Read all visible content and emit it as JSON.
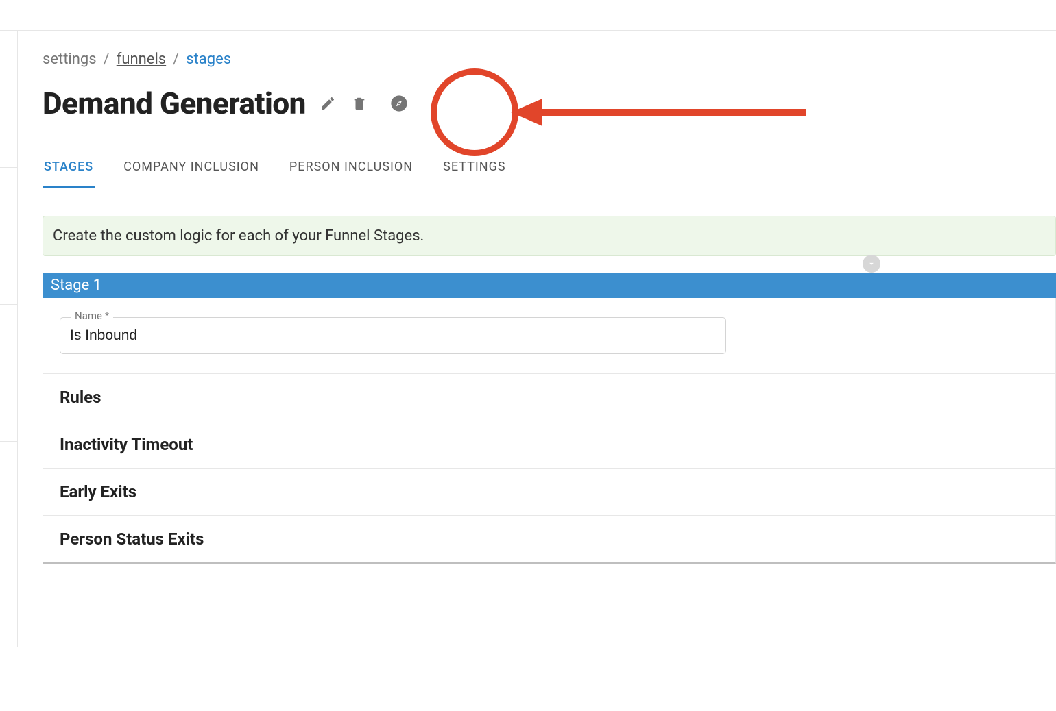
{
  "breadcrumb": {
    "settings": "settings",
    "funnels": "funnels",
    "stages": "stages"
  },
  "header": {
    "title": "Demand Generation"
  },
  "tabs": [
    {
      "label": "STAGES",
      "active": true
    },
    {
      "label": "COMPANY INCLUSION",
      "active": false
    },
    {
      "label": "PERSON INCLUSION",
      "active": false
    },
    {
      "label": "SETTINGS",
      "active": false
    }
  ],
  "banner": {
    "text": "Create the custom logic for each of your Funnel Stages."
  },
  "stage": {
    "header": "Stage 1",
    "name_label": "Name *",
    "name_value": "Is Inbound",
    "sections": [
      {
        "title": "Rules"
      },
      {
        "title": "Inactivity Timeout"
      },
      {
        "title": "Early Exits"
      },
      {
        "title": "Person Status Exits"
      }
    ]
  }
}
